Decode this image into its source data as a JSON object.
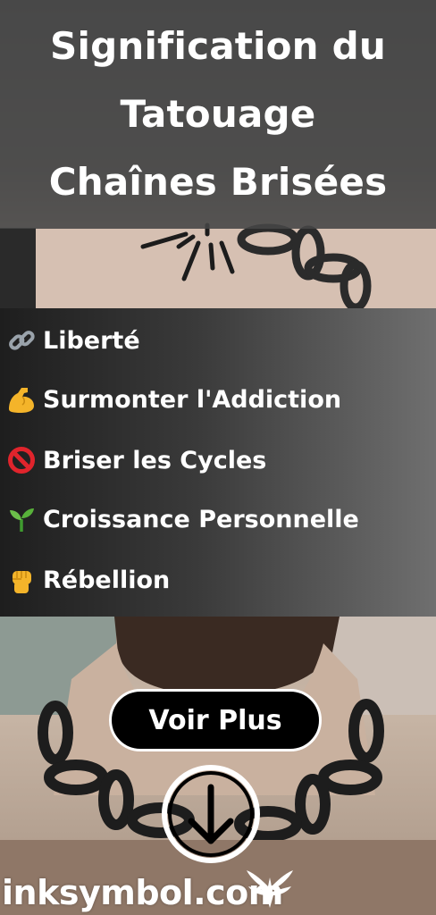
{
  "title": {
    "lines": [
      "Signification du",
      "Tatouage",
      "Chaînes Brisées"
    ]
  },
  "meanings": [
    {
      "icon": "link-icon",
      "label": "Liberté"
    },
    {
      "icon": "flexed-bicep-icon",
      "label": "Surmonter l'Addiction"
    },
    {
      "icon": "prohibited-icon",
      "label": "Briser les Cycles"
    },
    {
      "icon": "seedling-icon",
      "label": "Croissance Personnelle"
    },
    {
      "icon": "raised-fist-icon",
      "label": "Rébellion"
    }
  ],
  "cta": {
    "label": "Voir Plus"
  },
  "brand": {
    "name": "inksymbol.com"
  },
  "colors": {
    "overlay": "#464646",
    "text": "#ffffff",
    "button": "#000000"
  }
}
